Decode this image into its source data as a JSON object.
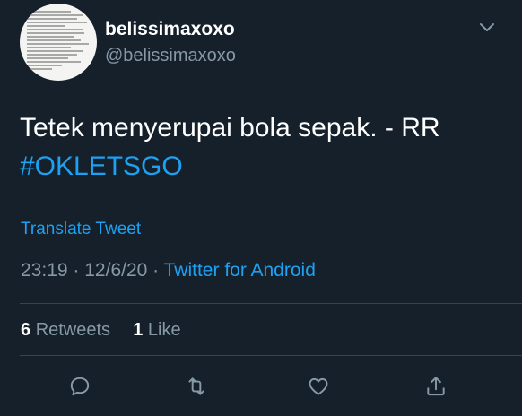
{
  "tweet": {
    "display_name": "belissimaxoxo",
    "handle": "@belissimaxoxo",
    "text": "Tetek menyerupai bola sepak. - RR",
    "hashtag": "#OKLETSGO",
    "translate_label": "Translate Tweet",
    "time": "23:19",
    "date": "12/6/20",
    "separator": "·",
    "source": "Twitter for Android",
    "retweet_count": "6",
    "retweet_label": "Retweets",
    "like_count": "1",
    "like_label": "Like"
  },
  "icons": {
    "caret": "chevron-down-icon",
    "reply": "reply-icon",
    "retweet": "retweet-icon",
    "like": "heart-icon",
    "share": "share-icon"
  },
  "colors": {
    "background": "#15202b",
    "accent": "#1da1f2",
    "secondary_text": "#8899a6",
    "primary_text": "#ffffff",
    "divider": "#38444d"
  }
}
